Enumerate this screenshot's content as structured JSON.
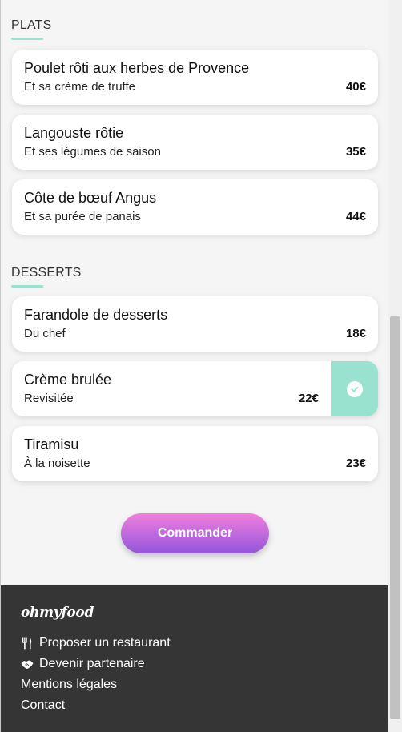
{
  "sections": {
    "plats": {
      "title": "PLATS",
      "items": [
        {
          "name": "Poulet rôti aux herbes de Provence",
          "desc": "Et sa crème de truffe",
          "price": "40€"
        },
        {
          "name": "Langouste rôtie",
          "desc": "Et ses légumes de saison",
          "price": "35€"
        },
        {
          "name": "Côte de bœuf Angus",
          "desc": "Et sa purée de panais",
          "price": "44€"
        }
      ]
    },
    "desserts": {
      "title": "DESSERTS",
      "items": [
        {
          "name": "Farandole de desserts",
          "desc": "Du chef",
          "price": "18€"
        },
        {
          "name": "Crème brulée",
          "desc": "Revisitée",
          "price": "22€",
          "selected": true
        },
        {
          "name": "Tiramisu",
          "desc": "À la noisette",
          "price": "23€"
        }
      ]
    }
  },
  "order_button": {
    "label": "Commander"
  },
  "footer": {
    "logo": "ohmyfood",
    "links": [
      {
        "label": "Proposer un restaurant",
        "icon": "utensils-icon"
      },
      {
        "label": "Devenir partenaire",
        "icon": "handshake-icon"
      },
      {
        "label": "Mentions légales"
      },
      {
        "label": "Contact"
      }
    ]
  },
  "colors": {
    "accent": "#99e2d0",
    "button_top": "#f07fdd",
    "button_bottom": "#9356dc",
    "footer_bg": "#353535"
  }
}
